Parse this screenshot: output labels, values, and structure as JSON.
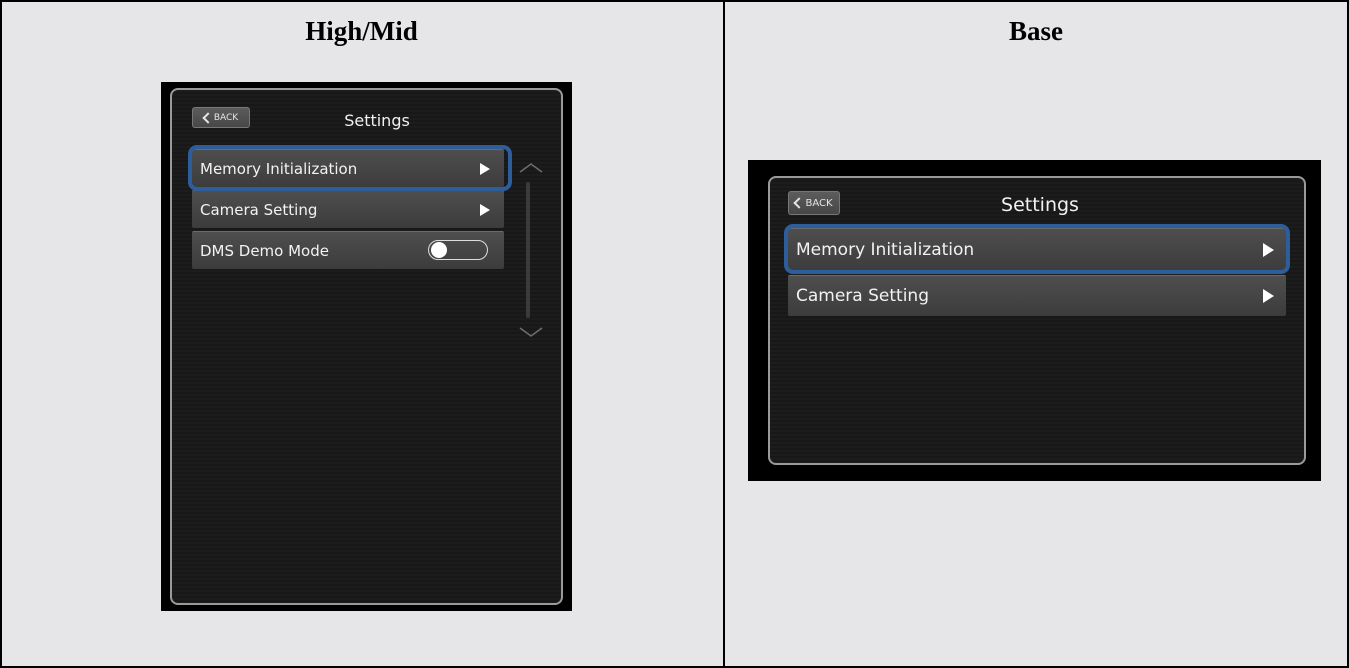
{
  "columns": {
    "left_title": "High/Mid",
    "right_title": "Base"
  },
  "high_mid": {
    "back_label": "BACK",
    "title": "Settings",
    "items": [
      {
        "label": "Memory Initialization",
        "control": "arrow",
        "highlighted": true
      },
      {
        "label": "Camera Setting",
        "control": "arrow",
        "highlighted": false
      },
      {
        "label": "DMS Demo Mode",
        "control": "toggle",
        "toggle_state": "off",
        "highlighted": false
      }
    ]
  },
  "base": {
    "back_label": "BACK",
    "title": "Settings",
    "items": [
      {
        "label": "Memory Initialization",
        "control": "arrow",
        "highlighted": true
      },
      {
        "label": "Camera Setting",
        "control": "arrow",
        "highlighted": false
      }
    ]
  },
  "colors": {
    "highlight": "#2e5d9c",
    "page_background": "#e6e6e8",
    "screen_background": "#1c1c1c"
  }
}
